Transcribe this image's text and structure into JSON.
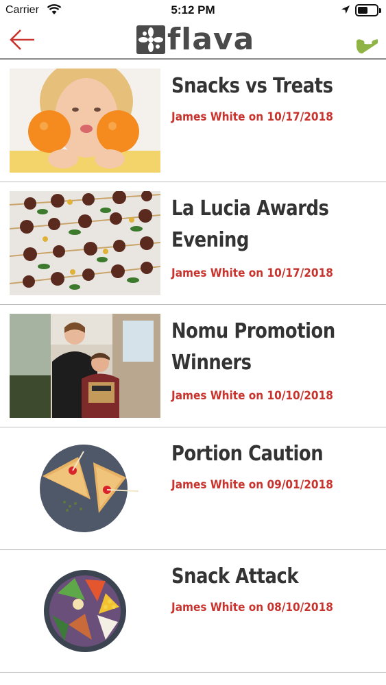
{
  "status_bar": {
    "carrier": "Carrier",
    "time": "5:12 PM",
    "icons": [
      "wifi-icon",
      "location-arrow-icon",
      "battery-icon"
    ]
  },
  "nav": {
    "back_icon": "arrow-left-icon",
    "logo_text": "flava",
    "phone_icon": "phone-icon",
    "colors": {
      "back": "#c8332d",
      "phone": "#8fb445",
      "logo": "#4a4a4a"
    }
  },
  "articles": [
    {
      "title": "Snacks vs Treats",
      "byline": "James White on 10/17/2018",
      "image": "girl-with-oranges"
    },
    {
      "title": "La Lucia Awards Evening",
      "byline": "James White on 10/17/2018",
      "image": "grilled-skewers"
    },
    {
      "title": "Nomu Promotion Winners",
      "byline": "James White on 10/10/2018",
      "image": "woman-and-boy-with-prize"
    },
    {
      "title": "Portion Caution",
      "byline": "James White on 09/01/2018",
      "image": "toasted-sandwich-plate"
    },
    {
      "title": "Snack Attack",
      "byline": "James White on 08/10/2018",
      "image": "salad-bowl"
    }
  ],
  "theme": {
    "accent": "#c8332d",
    "title": "#333333",
    "divider": "#bdbdbd"
  }
}
